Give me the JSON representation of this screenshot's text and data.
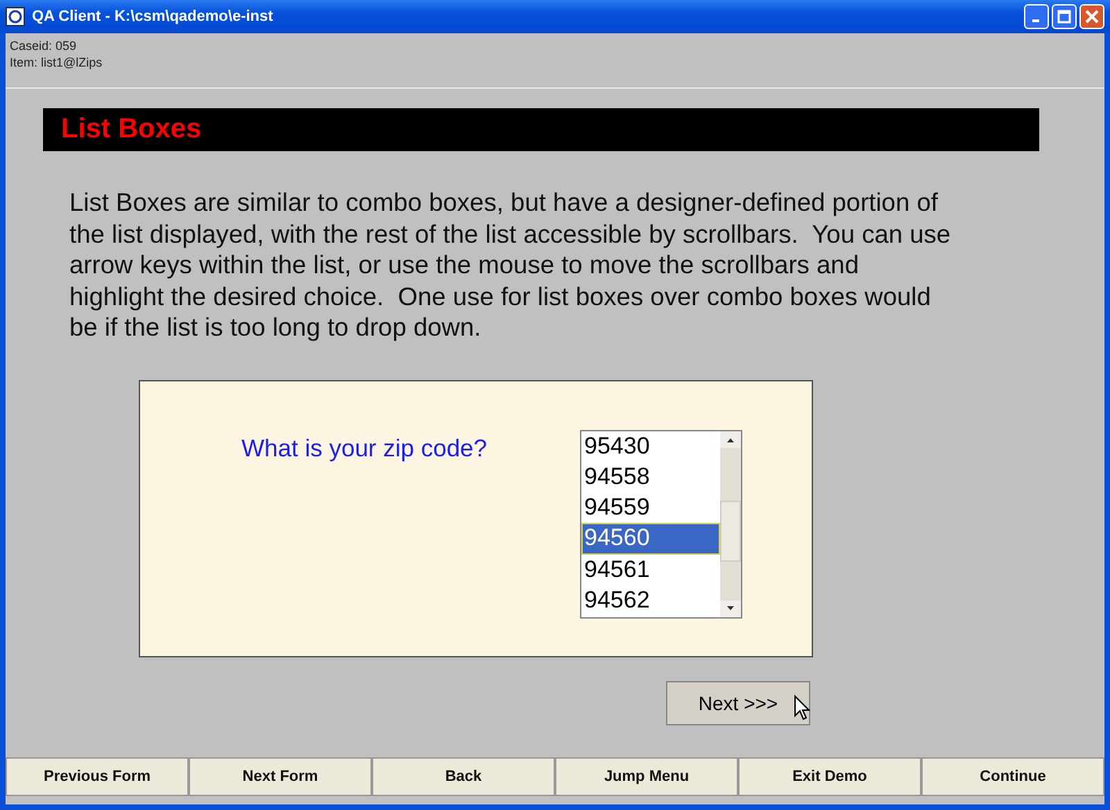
{
  "window": {
    "title": "QA Client - K:\\csm\\qademo\\e-inst"
  },
  "info": [
    "Caseid: 059",
    "Item: list1@lZips"
  ],
  "header": "List Boxes",
  "paragraph": "List Boxes are similar to combo boxes, but have a designer-defined portion of the list displayed, with the rest of the list accessible by scrollbars.  You can use arrow keys within the list, or use the mouse to move the scrollbars and highlight the desired choice.  One use for list boxes over combo boxes would be if the list is too long to drop down.",
  "question": "What is your zip code?",
  "list": [
    {
      "label": "95430",
      "selected": false
    },
    {
      "label": "94558",
      "selected": false
    },
    {
      "label": "94559",
      "selected": false
    },
    {
      "label": "94560",
      "selected": true
    },
    {
      "label": "94561",
      "selected": false
    },
    {
      "label": "94562",
      "selected": false
    }
  ],
  "next_button": "Next >>>",
  "nav_buttons": [
    "Previous Form",
    "Next Form",
    "Back",
    "Jump Menu",
    "Exit Demo",
    "Continue"
  ]
}
